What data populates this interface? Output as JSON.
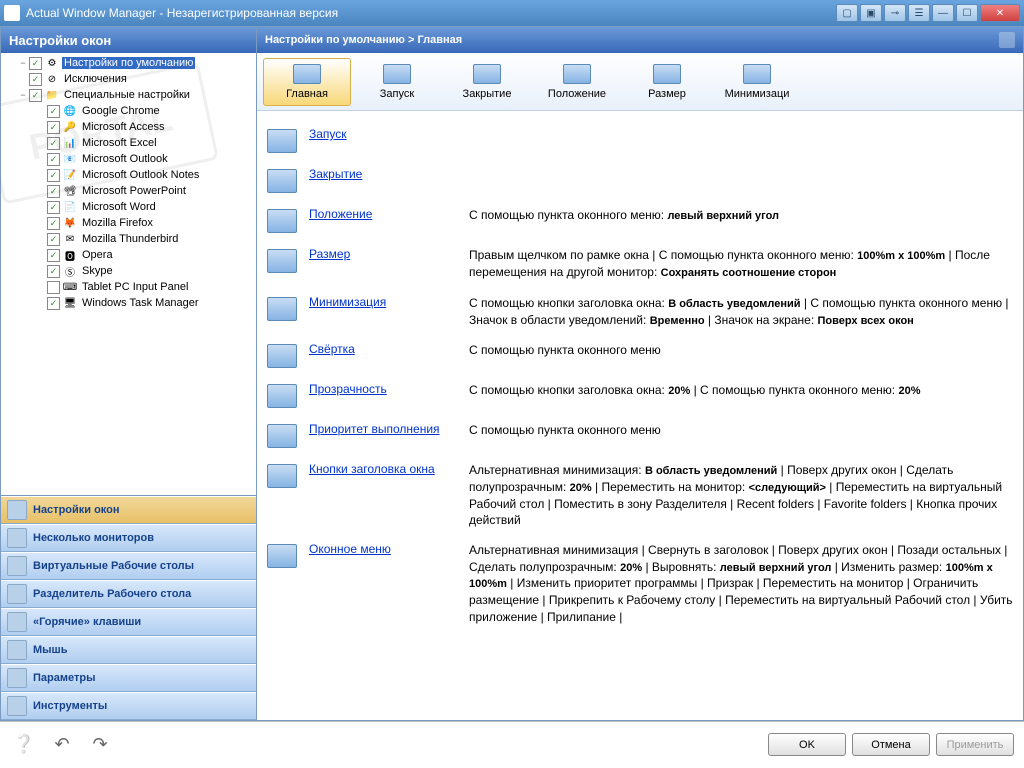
{
  "window": {
    "title": "Actual Window Manager - Незарегистрированная версия"
  },
  "left": {
    "header": "Настройки окон",
    "tree": [
      {
        "level": 0,
        "expand": "−",
        "check": true,
        "icon": "⚙",
        "label": "Настройки по умолчанию",
        "selected": true
      },
      {
        "level": 0,
        "expand": "",
        "check": true,
        "icon": "⊘",
        "label": "Исключения"
      },
      {
        "level": 0,
        "expand": "−",
        "check": true,
        "icon": "📁",
        "label": "Специальные настройки"
      },
      {
        "level": 1,
        "expand": "",
        "check": true,
        "icon": "🌐",
        "label": "Google Chrome"
      },
      {
        "level": 1,
        "expand": "",
        "check": true,
        "icon": "🔑",
        "label": "Microsoft Access"
      },
      {
        "level": 1,
        "expand": "",
        "check": true,
        "icon": "📊",
        "label": "Microsoft Excel"
      },
      {
        "level": 1,
        "expand": "",
        "check": true,
        "icon": "📧",
        "label": "Microsoft Outlook"
      },
      {
        "level": 1,
        "expand": "",
        "check": true,
        "icon": "📝",
        "label": "Microsoft Outlook Notes"
      },
      {
        "level": 1,
        "expand": "",
        "check": true,
        "icon": "📽",
        "label": "Microsoft PowerPoint"
      },
      {
        "level": 1,
        "expand": "",
        "check": true,
        "icon": "📄",
        "label": "Microsoft Word"
      },
      {
        "level": 1,
        "expand": "",
        "check": true,
        "icon": "🦊",
        "label": "Mozilla Firefox"
      },
      {
        "level": 1,
        "expand": "",
        "check": true,
        "icon": "✉",
        "label": "Mozilla Thunderbird"
      },
      {
        "level": 1,
        "expand": "",
        "check": true,
        "icon": "🅾",
        "label": "Opera"
      },
      {
        "level": 1,
        "expand": "",
        "check": true,
        "icon": "Ⓢ",
        "label": "Skype"
      },
      {
        "level": 1,
        "expand": "",
        "check": false,
        "icon": "⌨",
        "label": "Tablet PC Input Panel"
      },
      {
        "level": 1,
        "expand": "",
        "check": true,
        "icon": "🖥",
        "label": "Windows Task Manager"
      }
    ],
    "nav": [
      {
        "label": "Настройки окон",
        "active": true
      },
      {
        "label": "Несколько мониторов"
      },
      {
        "label": "Виртуальные Рабочие столы"
      },
      {
        "label": "Разделитель Рабочего стола"
      },
      {
        "label": "«Горячие» клавиши"
      },
      {
        "label": "Мышь"
      },
      {
        "label": "Параметры"
      },
      {
        "label": "Инструменты"
      }
    ]
  },
  "right": {
    "breadcrumb": "Настройки по умолчанию > Главная",
    "tabs": [
      {
        "label": "Главная",
        "active": true
      },
      {
        "label": "Запуск"
      },
      {
        "label": "Закрытие"
      },
      {
        "label": "Положение"
      },
      {
        "label": "Размер"
      },
      {
        "label": "Минимизаци"
      }
    ],
    "sections": [
      {
        "link": "Запуск",
        "desc": ""
      },
      {
        "link": "Закрытие",
        "desc": ""
      },
      {
        "link": "Положение",
        "desc": "С помощью пункта оконного меню: <b>левый верхний угол</b>"
      },
      {
        "link": "Размер",
        "desc": "Правым щелчком по рамке окна | С помощью пункта оконного меню: <b>100%m x 100%m</b> | После перемещения на другой монитор: <b>Сохранять соотношение сторон</b>"
      },
      {
        "link": "Минимизация",
        "desc": "С помощью кнопки заголовка окна: <b>В область уведомлений</b> | С помощью пункта оконного меню | Значок в области уведомлений: <b>Временно</b> | Значок на экране: <b>Поверх всех окон</b>"
      },
      {
        "link": "Свёртка",
        "desc": "С помощью пункта оконного меню"
      },
      {
        "link": "Прозрачность",
        "desc": "С помощью кнопки заголовка окна: <b>20%</b> | С помощью пункта оконного меню: <b>20%</b>"
      },
      {
        "link": "Приоритет выполнения",
        "desc": "С помощью пункта оконного меню"
      },
      {
        "link": "Кнопки заголовка окна",
        "desc": "Альтернативная минимизация: <b>В область уведомлений</b> | Поверх других окон | Сделать полупрозрачным: <b>20%</b> | Переместить на монитор: <b>&lt;следующий&gt;</b> | Переместить на виртуальный Рабочий стол | Поместить в зону Разделителя | Recent folders | Favorite folders | Кнопка прочих действий"
      },
      {
        "link": "Оконное меню",
        "desc": "Альтернативная минимизация | Свернуть в заголовок | Поверх других окон | Позади остальных | Сделать полупрозрачным: <b>20%</b> | Выровнять: <b>левый верхний угол</b> | Изменить размер: <b>100%m x 100%m</b> | Изменить приоритет программы | Призрак | Переместить на монитор | Ограничить размещение | Прикрепить к Рабочему столу | Переместить на виртуальный Рабочий стол | Убить приложение | Прилипание |"
      }
    ]
  },
  "bottom": {
    "ok": "OK",
    "cancel": "Отмена",
    "apply": "Применить"
  },
  "watermark": "PORTAL"
}
